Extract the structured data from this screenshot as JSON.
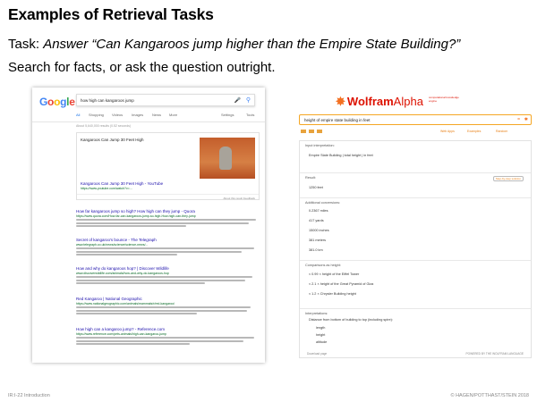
{
  "slide": {
    "title": "Examples of Retrieval Tasks",
    "task_prefix": "Task: ",
    "task_question": "Answer “Can Kangaroos jump higher than the Empire State Building?”",
    "search_line": "Search for facts, or ask the question outright."
  },
  "google": {
    "logo_letters": [
      {
        "t": "G",
        "c": "#4285f4"
      },
      {
        "t": "o",
        "c": "#ea4335"
      },
      {
        "t": "o",
        "c": "#fbbc05"
      },
      {
        "t": "g",
        "c": "#4285f4"
      },
      {
        "t": "l",
        "c": "#34a853"
      },
      {
        "t": "e",
        "c": "#ea4335"
      }
    ],
    "query": "how high can kangaroos jump",
    "tabs": [
      "All",
      "Shopping",
      "Videos",
      "Images",
      "News",
      "More",
      "Settings",
      "Tools"
    ],
    "stats": "About 5,640,000 results (0.52 seconds)",
    "featured": {
      "title": "Kangaroos Can Jump 30 Feet High",
      "link": "Kangaroos Can Jump 30 Feet High - YouTube",
      "url": "https://www.youtube.com/watch?v=...",
      "footer": "About this result    Feedback"
    },
    "results": [
      {
        "title": "How far kangaroos jump so high? How high can they jump - Quora",
        "url": "https://www.quora.com/How-far-can-kangaroos-jump-so-high-How-high-can-they-jump"
      },
      {
        "title": "Secret of kangaroo's bounce - The Telegraph",
        "url": "www.telegraph.co.uk/news/science/science-news/..."
      },
      {
        "title": "How and why do kangaroos hop? | Discover Wildlife",
        "url": "www.discoverwildlife.com/animals/how-and-why-do-kangaroos-hop"
      },
      {
        "title": "Red Kangaroo | National Geographic",
        "url": "https://www.nationalgeographic.com/animals/mammals/r/red-kangaroo/"
      },
      {
        "title": "How high can a kangaroo jump? - Reference.com",
        "url": "https://www.reference.com/pets-animals/high-can-kangaroo-jump"
      }
    ]
  },
  "wolfram": {
    "logo_main": "Wolfram",
    "logo_alpha": "Alpha",
    "tagline": "computational knowledge engine",
    "query": "height of empire state building in feet",
    "toolbar_right": [
      "Web Apps",
      "Examples",
      "Random"
    ],
    "pods": {
      "input_title": "Input interpretation:",
      "input_value": "Empire State Building  |  total height  |  in feet",
      "result_title": "Result:",
      "result_value": "1250 feet",
      "show_steps": "Step-by-step solution",
      "units_title": "Additional conversions:",
      "units": [
        "0.2367 miles",
        "417 yards",
        "15000 inches",
        "381 meters",
        "381.0 km"
      ],
      "comparisons_title": "Comparisons as height:",
      "comparisons": [
        "≈ 0.99 × height of the Eiffel Tower",
        "≈ 2.1 × height of the Great Pyramid of Giza",
        "≈ 1.2 × Chrysler Building height"
      ],
      "interpretations_title": "Interpretations:",
      "interpretations_sub": "Distance from bottom of building to top (including spire):",
      "interpretations": [
        "length",
        "height",
        "altitude"
      ],
      "footer_left": "Download page",
      "footer_right": "POWERED BY THE WOLFRAM LANGUAGE"
    }
  },
  "footer": {
    "left": "IR:I-22   Introduction",
    "right": "© HAGEN/POTTHAST/STEIN 2018"
  }
}
